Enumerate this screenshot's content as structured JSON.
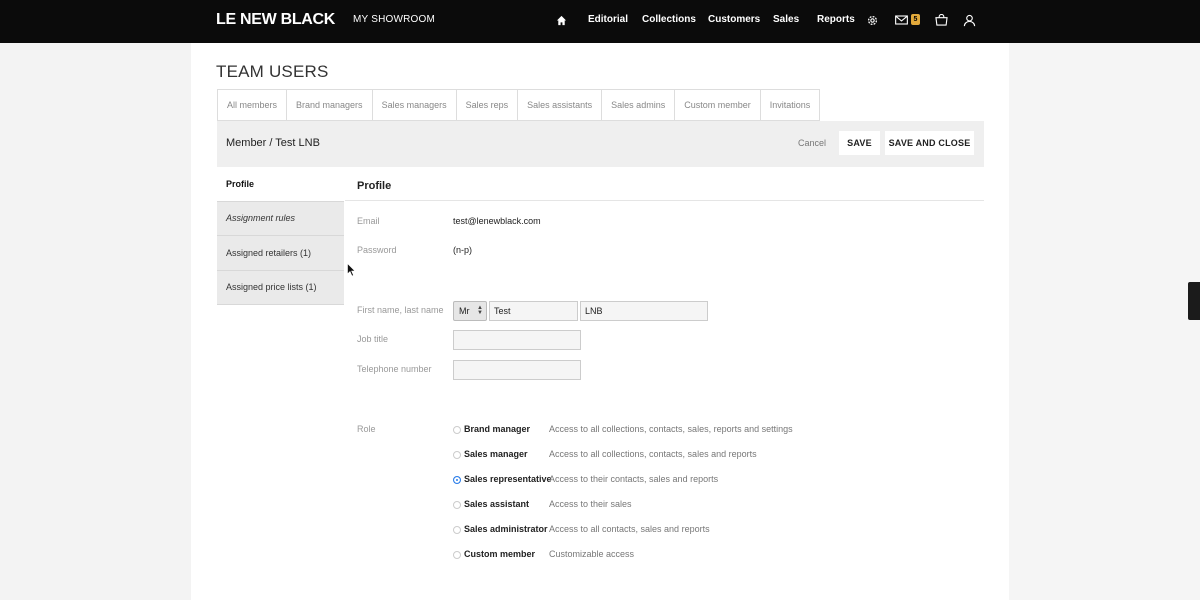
{
  "brand": {
    "logo": "LE NEW BLACK",
    "showroom": "MY SHOWROOM",
    "badge_count": "5"
  },
  "nav": {
    "items": [
      "Editorial",
      "Collections",
      "Customers",
      "Sales",
      "Reports"
    ],
    "icons": [
      "home-icon",
      "gear-icon",
      "mail-icon",
      "bag-icon",
      "user-icon"
    ]
  },
  "page": {
    "title": "TEAM USERS"
  },
  "tabs": [
    "All members",
    "Brand managers",
    "Sales managers",
    "Sales reps",
    "Sales assistants",
    "Sales admins",
    "Custom member",
    "Invitations"
  ],
  "subheader": {
    "breadcrumb": "Member / Test LNB",
    "cancel": "Cancel",
    "save": "SAVE",
    "save_close": "SAVE AND CLOSE"
  },
  "sidemenu": [
    "Profile",
    "Assignment rules",
    "Assigned retailers (1)",
    "Assigned price lists (1)"
  ],
  "profile": {
    "title": "Profile",
    "email_label": "Email",
    "email_value": "test@lenewblack.com",
    "password_label": "Password",
    "password_value": "(n-p)",
    "name_label": "First name, last name",
    "salutation": "Mr",
    "first_name": "Test",
    "last_name": "LNB",
    "job_label": "Job title",
    "job_value": "",
    "phone_label": "Telephone number",
    "phone_value": "",
    "role_label": "Role"
  },
  "roles": [
    {
      "name": "Brand manager",
      "desc": "Access to all collections, contacts, sales, reports and settings",
      "checked": false
    },
    {
      "name": "Sales manager",
      "desc": "Access to all collections, contacts, sales and reports",
      "checked": false
    },
    {
      "name": "Sales representative",
      "desc": "Access to their contacts, sales and reports",
      "checked": true
    },
    {
      "name": "Sales assistant",
      "desc": "Access to their sales",
      "checked": false
    },
    {
      "name": "Sales administrator",
      "desc": "Access to all contacts, sales and reports",
      "checked": false
    },
    {
      "name": "Custom member",
      "desc": "Customizable access",
      "checked": false
    }
  ],
  "colors": {
    "nav_bg": "#0b0b0b",
    "accent": "#2b7de9",
    "badge": "#e2a93b"
  }
}
